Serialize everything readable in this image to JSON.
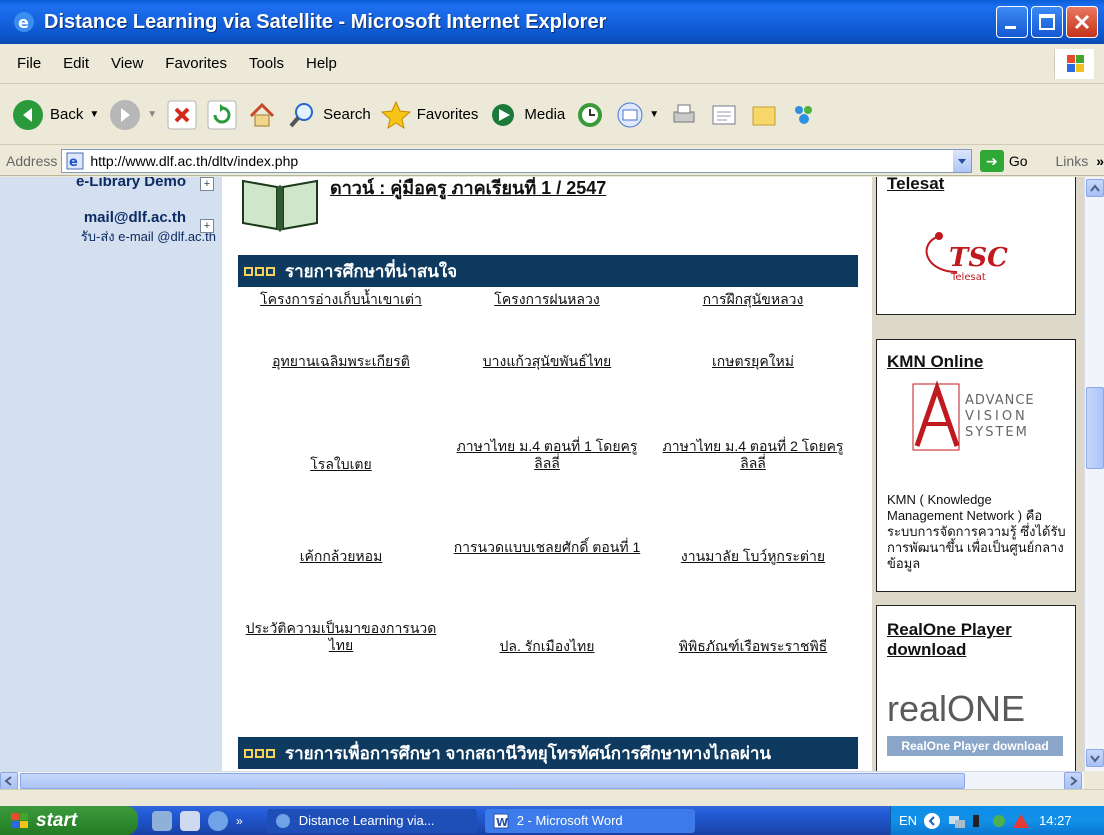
{
  "window": {
    "title": "Distance Learning via Satellite - Microsoft Internet Explorer"
  },
  "menubar": {
    "items": [
      "File",
      "Edit",
      "View",
      "Favorites",
      "Tools",
      "Help"
    ]
  },
  "toolbar": {
    "back": "Back",
    "search": "Search",
    "favorites": "Favorites",
    "media": "Media"
  },
  "address": {
    "label": "Address",
    "url": "http://www.dlf.ac.th/dltv/index.php",
    "go": "Go",
    "links": "Links"
  },
  "leftnav": {
    "items": [
      {
        "title": "e-Library Demo",
        "sub": ""
      },
      {
        "title": "mail@dlf.ac.th",
        "sub": "รับ-ส่ง e-mail @dlf.ac.th"
      }
    ]
  },
  "main": {
    "top_link": "ดาวน์ : คู่มือครู ภาคเรียนที่ 1 / 2547",
    "section1": "รายการศึกษาที่น่าสนใจ",
    "section2": "รายการเพื่อการศึกษา จากสถานีวิทยุโทรทัศน์การศึกษาทางไกลผ่าน",
    "links": [
      [
        "โครงการอ่างเก็บน้ำเขาเต่า",
        "โครงการฝนหลวง",
        "การฝึกสุนัขหลวง"
      ],
      [
        "อุทยานเฉลิมพระเกียรติ",
        "บางแก้วสุนัขพันธ์ไทย",
        "เกษตรยุคใหม่"
      ],
      [
        "โรลใบเตย",
        "ภาษาไทย ม.4 ตอนที่ 1 โดยครูลิลลี่",
        "ภาษาไทย ม.4 ตอนที่ 2 โดยครูลิลลี่"
      ],
      [
        "เค้กกล้วยหอม",
        "การนวดแบบเชลยศักดิ์ ตอนที่ 1",
        "งานมาลัย โบว์หูกระต่าย"
      ],
      [
        "ประวัติความเป็นมาของการนวดไทย",
        "ปล. รักเมืองไทย",
        "พิพิธภัณฑ์เรือพระราชพิธี"
      ]
    ]
  },
  "rightcol": {
    "telesat_title": "Telesat",
    "telesat_logo_text": "TSC",
    "telesat_logo_sub": "Telesat",
    "kmn_title": "KMN Online",
    "avs_lines": [
      "ADVANCE",
      "VISION",
      "SYSTEM"
    ],
    "kmn_text": "KMN ( Knowledge Management Network ) คือ ระบบการจัดการความรู้ ซึ่งได้รับการพัฒนาขึ้น เพื่อเป็นศูนย์กลางข้อมูล",
    "real_title": "RealOne Player download",
    "real_logo": "realONE",
    "real_caption": "RealOne Player download"
  },
  "taskbar": {
    "start": "start",
    "task1": "Distance Learning via...",
    "task2": "2 - Microsoft Word",
    "lang": "EN",
    "clock": "14:27"
  }
}
